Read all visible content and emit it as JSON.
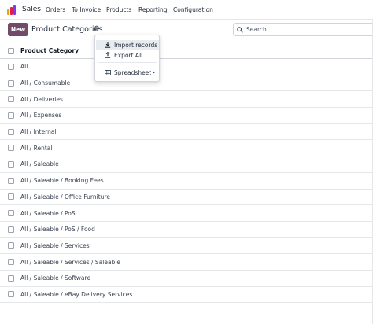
{
  "navbar": {
    "app_name": "Sales",
    "menu": [
      "Orders",
      "To Invoice",
      "Products",
      "Reporting",
      "Configuration"
    ],
    "app_icon_colors": [
      "#f59e0b",
      "#e11d48",
      "#7c3aed"
    ]
  },
  "control_panel": {
    "new_label": "New",
    "title": "Product Categories",
    "gear_icon": "gear-icon",
    "search_placeholder": "Search..."
  },
  "list": {
    "header": "Product Category",
    "rows": [
      "All",
      "All / Consumable",
      "All / Deliveries",
      "All / Expenses",
      "All / Internal",
      "All / Rental",
      "All / Saleable",
      "All / Saleable / Booking Fees",
      "All / Saleable / Office Furniture",
      "All / Saleable / PoS",
      "All / Saleable / PoS / Food",
      "All / Saleable / Services",
      "All / Saleable / Services / Saleable",
      "All / Saleable / Software",
      "All / Saleable / eBay Delivery Services"
    ]
  },
  "dropdown": {
    "items": [
      {
        "label": "Import records",
        "icon": "download-icon",
        "active": true
      },
      {
        "label": "Export All",
        "icon": "upload-icon",
        "active": false
      },
      {
        "label": "Spreadsheet",
        "icon": "spreadsheet-icon",
        "active": false,
        "submenu": true
      }
    ]
  },
  "colors": {
    "brand": "#714b67",
    "border": "#e5e7eb",
    "text": "#374151"
  }
}
